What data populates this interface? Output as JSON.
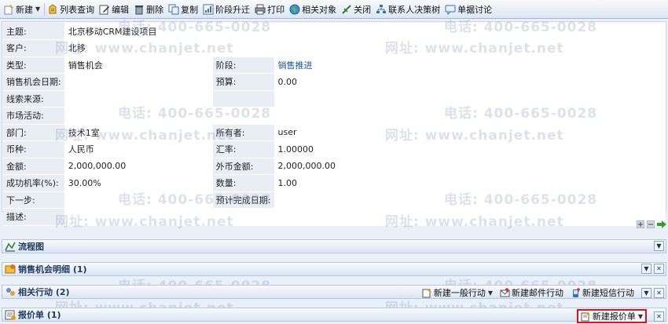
{
  "toolbar": {
    "new": "新建",
    "list_query": "列表查询",
    "edit": "编辑",
    "delete": "删除",
    "copy": "复制",
    "stage_upgrade": "阶段升迁",
    "print": "打印",
    "related": "相关对象",
    "close": "关闭",
    "decision_tree": "联系人决策树",
    "discuss": "单据讨论"
  },
  "form": {
    "subject_label": "主题:",
    "subject_value": "北京移动CRM建设项目",
    "customer_label": "客户:",
    "customer_value": "北移",
    "type_label": "类型:",
    "type_value": "销售机会",
    "stage_label": "阶段:",
    "stage_value": "销售推进",
    "date_label": "销售机会日期:",
    "date_value": "",
    "budget_label": "预算:",
    "budget_value": "0.00",
    "lead_label": "线索来源:",
    "lead_value": "",
    "campaign_label": "市场活动:",
    "campaign_value": "",
    "dept_label": "部门:",
    "dept_value": "技术1室",
    "owner_label": "所有者:",
    "owner_value": "user",
    "currency_label": "币种:",
    "currency_value": "人民币",
    "rate_label": "汇率:",
    "rate_value": "1.00000",
    "amount_label": "金额:",
    "amount_value": "2,000,000.00",
    "foreign_amount_label": "外币金额:",
    "foreign_amount_value": "2,000,000.00",
    "probability_label": "成功机率(%):",
    "probability_value": "30.00%",
    "quantity_label": "数量:",
    "quantity_value": "1.00",
    "next_step_label": "下一步:",
    "next_step_value": "",
    "est_date_label": "预计完成日期:",
    "est_date_value": "",
    "desc_label": "描述:",
    "desc_value": ""
  },
  "watermarks": {
    "phone": "电话: 400-665-0028",
    "site": "网址: www.chanjet.net"
  },
  "panels": {
    "flow": "流程图",
    "details": "销售机会明细 (1)",
    "actions": "相关行动 (2)",
    "quotes": "报价单 (1)"
  },
  "actions": {
    "new_general": "新建一般行动",
    "new_email": "新建邮件行动",
    "new_sms": "新建短信行动",
    "new_quote": "新建报价单"
  },
  "colors": {
    "accent": "#1d55a0",
    "highlight_border": "#d8161c",
    "panel_bg": "#dbe5f2"
  }
}
